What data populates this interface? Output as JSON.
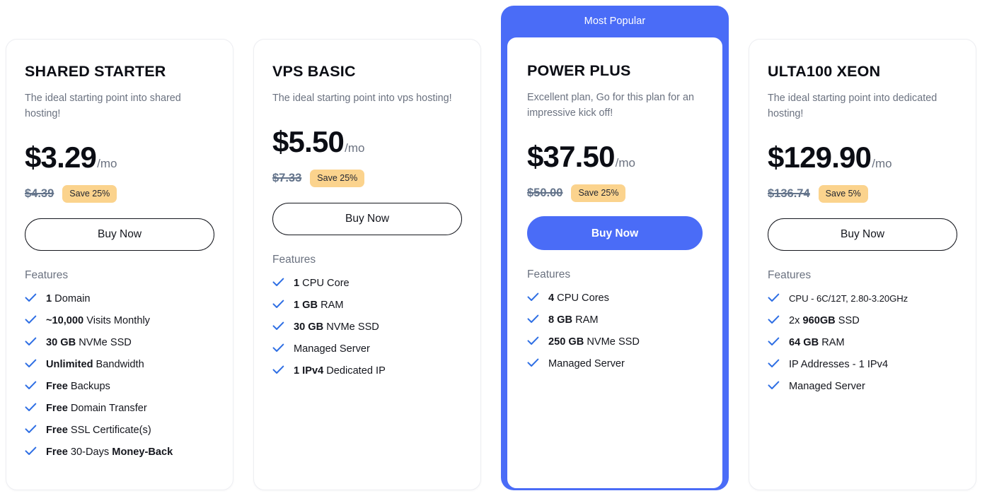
{
  "theme": {
    "accent": "#4a6cf7",
    "badge_bg": "#fbd38d",
    "check_color": "#2f6fe4",
    "muted_text": "#6b7280",
    "page_bg": "#ffffff"
  },
  "plans": [
    {
      "name": "SHARED STARTER",
      "tagline": "The ideal starting point into shared hosting!",
      "price": "$3.29",
      "period": "/mo",
      "old_price": "$4.39",
      "save_badge": "Save 25%",
      "cta": "Buy Now",
      "features_label": "Features",
      "featured": false,
      "features": [
        {
          "bold": "1",
          "rest": " Domain"
        },
        {
          "bold": "~10,000",
          "rest": " Visits Monthly"
        },
        {
          "bold": "30 GB",
          "rest": " NVMe SSD"
        },
        {
          "bold": "Unlimited",
          "rest": " Bandwidth"
        },
        {
          "bold": "Free",
          "rest": " Backups"
        },
        {
          "bold": "Free",
          "rest": " Domain Transfer"
        },
        {
          "bold": "Free",
          "rest": " SSL Certificate(s)"
        },
        {
          "bold": "Free",
          "rest": " 30-Days ",
          "bold2": "Money-Back"
        }
      ]
    },
    {
      "name": "VPS BASIC",
      "tagline": "The ideal starting point into vps hosting!",
      "price": "$5.50",
      "period": "/mo",
      "old_price": "$7.33",
      "save_badge": "Save 25%",
      "cta": "Buy Now",
      "features_label": "Features",
      "featured": false,
      "features": [
        {
          "bold": "1",
          "rest": " CPU Core"
        },
        {
          "bold": "1 GB",
          "rest": " RAM"
        },
        {
          "bold": "30 GB",
          "rest": " NVMe SSD"
        },
        {
          "bold": "",
          "rest": "Managed Server"
        },
        {
          "bold": "1 IPv4",
          "rest": " Dedicated IP"
        }
      ]
    },
    {
      "name": "POWER PLUS",
      "banner": "Most Popular",
      "tagline": "Excellent plan, Go for this plan for an impressive kick off!",
      "price": "$37.50",
      "period": "/mo",
      "old_price": "$50.00",
      "save_badge": "Save 25%",
      "cta": "Buy Now",
      "features_label": "Features",
      "featured": true,
      "features": [
        {
          "bold": "4",
          "rest": " CPU Cores"
        },
        {
          "bold": "8 GB",
          "rest": " RAM"
        },
        {
          "bold": "250 GB",
          "rest": " NVMe SSD"
        },
        {
          "bold": "",
          "rest": "Managed Server"
        }
      ]
    },
    {
      "name": "ULTA100 XEON",
      "tagline": "The ideal starting point into dedicated hosting!",
      "price": "$129.90",
      "period": "/mo",
      "old_price": "$136.74",
      "save_badge": "Save 5%",
      "cta": "Buy Now",
      "features_label": "Features",
      "featured": false,
      "features": [
        {
          "bold": "",
          "rest": "CPU - 6C/12T, 2.80-3.20GHz",
          "small": true
        },
        {
          "bold": "",
          "rest": "2x ",
          "bold2": "960GB",
          "rest2": " SSD"
        },
        {
          "bold": "64 GB",
          "rest": " RAM"
        },
        {
          "bold": "",
          "rest": "IP Addresses - 1 IPv4"
        },
        {
          "bold": "",
          "rest": "Managed Server"
        }
      ]
    }
  ]
}
